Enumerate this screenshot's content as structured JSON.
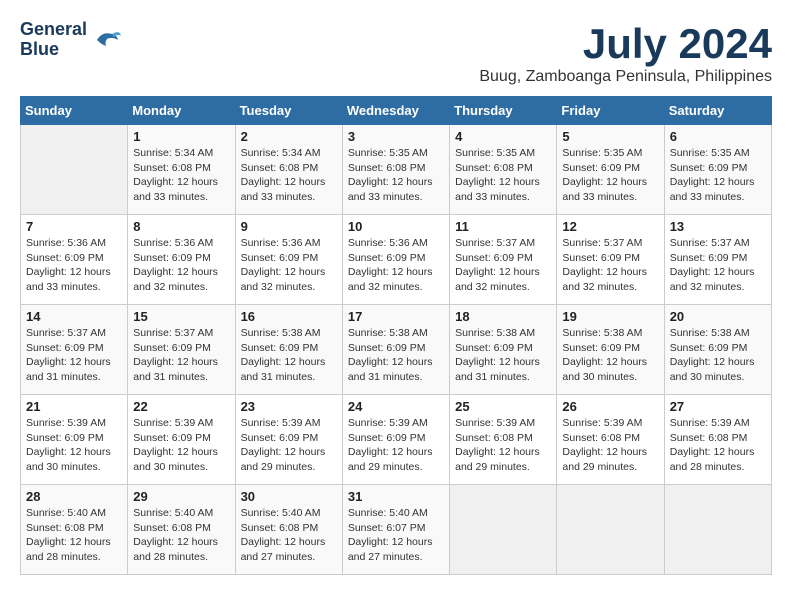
{
  "logo": {
    "line1": "General",
    "line2": "Blue"
  },
  "title": "July 2024",
  "location": "Buug, Zamboanga Peninsula, Philippines",
  "headers": [
    "Sunday",
    "Monday",
    "Tuesday",
    "Wednesday",
    "Thursday",
    "Friday",
    "Saturday"
  ],
  "weeks": [
    [
      {
        "day": "",
        "sunrise": "",
        "sunset": "",
        "daylight": ""
      },
      {
        "day": "1",
        "sunrise": "Sunrise: 5:34 AM",
        "sunset": "Sunset: 6:08 PM",
        "daylight": "Daylight: 12 hours and 33 minutes."
      },
      {
        "day": "2",
        "sunrise": "Sunrise: 5:34 AM",
        "sunset": "Sunset: 6:08 PM",
        "daylight": "Daylight: 12 hours and 33 minutes."
      },
      {
        "day": "3",
        "sunrise": "Sunrise: 5:35 AM",
        "sunset": "Sunset: 6:08 PM",
        "daylight": "Daylight: 12 hours and 33 minutes."
      },
      {
        "day": "4",
        "sunrise": "Sunrise: 5:35 AM",
        "sunset": "Sunset: 6:08 PM",
        "daylight": "Daylight: 12 hours and 33 minutes."
      },
      {
        "day": "5",
        "sunrise": "Sunrise: 5:35 AM",
        "sunset": "Sunset: 6:09 PM",
        "daylight": "Daylight: 12 hours and 33 minutes."
      },
      {
        "day": "6",
        "sunrise": "Sunrise: 5:35 AM",
        "sunset": "Sunset: 6:09 PM",
        "daylight": "Daylight: 12 hours and 33 minutes."
      }
    ],
    [
      {
        "day": "7",
        "sunrise": "Sunrise: 5:36 AM",
        "sunset": "Sunset: 6:09 PM",
        "daylight": "Daylight: 12 hours and 33 minutes."
      },
      {
        "day": "8",
        "sunrise": "Sunrise: 5:36 AM",
        "sunset": "Sunset: 6:09 PM",
        "daylight": "Daylight: 12 hours and 32 minutes."
      },
      {
        "day": "9",
        "sunrise": "Sunrise: 5:36 AM",
        "sunset": "Sunset: 6:09 PM",
        "daylight": "Daylight: 12 hours and 32 minutes."
      },
      {
        "day": "10",
        "sunrise": "Sunrise: 5:36 AM",
        "sunset": "Sunset: 6:09 PM",
        "daylight": "Daylight: 12 hours and 32 minutes."
      },
      {
        "day": "11",
        "sunrise": "Sunrise: 5:37 AM",
        "sunset": "Sunset: 6:09 PM",
        "daylight": "Daylight: 12 hours and 32 minutes."
      },
      {
        "day": "12",
        "sunrise": "Sunrise: 5:37 AM",
        "sunset": "Sunset: 6:09 PM",
        "daylight": "Daylight: 12 hours and 32 minutes."
      },
      {
        "day": "13",
        "sunrise": "Sunrise: 5:37 AM",
        "sunset": "Sunset: 6:09 PM",
        "daylight": "Daylight: 12 hours and 32 minutes."
      }
    ],
    [
      {
        "day": "14",
        "sunrise": "Sunrise: 5:37 AM",
        "sunset": "Sunset: 6:09 PM",
        "daylight": "Daylight: 12 hours and 31 minutes."
      },
      {
        "day": "15",
        "sunrise": "Sunrise: 5:37 AM",
        "sunset": "Sunset: 6:09 PM",
        "daylight": "Daylight: 12 hours and 31 minutes."
      },
      {
        "day": "16",
        "sunrise": "Sunrise: 5:38 AM",
        "sunset": "Sunset: 6:09 PM",
        "daylight": "Daylight: 12 hours and 31 minutes."
      },
      {
        "day": "17",
        "sunrise": "Sunrise: 5:38 AM",
        "sunset": "Sunset: 6:09 PM",
        "daylight": "Daylight: 12 hours and 31 minutes."
      },
      {
        "day": "18",
        "sunrise": "Sunrise: 5:38 AM",
        "sunset": "Sunset: 6:09 PM",
        "daylight": "Daylight: 12 hours and 31 minutes."
      },
      {
        "day": "19",
        "sunrise": "Sunrise: 5:38 AM",
        "sunset": "Sunset: 6:09 PM",
        "daylight": "Daylight: 12 hours and 30 minutes."
      },
      {
        "day": "20",
        "sunrise": "Sunrise: 5:38 AM",
        "sunset": "Sunset: 6:09 PM",
        "daylight": "Daylight: 12 hours and 30 minutes."
      }
    ],
    [
      {
        "day": "21",
        "sunrise": "Sunrise: 5:39 AM",
        "sunset": "Sunset: 6:09 PM",
        "daylight": "Daylight: 12 hours and 30 minutes."
      },
      {
        "day": "22",
        "sunrise": "Sunrise: 5:39 AM",
        "sunset": "Sunset: 6:09 PM",
        "daylight": "Daylight: 12 hours and 30 minutes."
      },
      {
        "day": "23",
        "sunrise": "Sunrise: 5:39 AM",
        "sunset": "Sunset: 6:09 PM",
        "daylight": "Daylight: 12 hours and 29 minutes."
      },
      {
        "day": "24",
        "sunrise": "Sunrise: 5:39 AM",
        "sunset": "Sunset: 6:09 PM",
        "daylight": "Daylight: 12 hours and 29 minutes."
      },
      {
        "day": "25",
        "sunrise": "Sunrise: 5:39 AM",
        "sunset": "Sunset: 6:08 PM",
        "daylight": "Daylight: 12 hours and 29 minutes."
      },
      {
        "day": "26",
        "sunrise": "Sunrise: 5:39 AM",
        "sunset": "Sunset: 6:08 PM",
        "daylight": "Daylight: 12 hours and 29 minutes."
      },
      {
        "day": "27",
        "sunrise": "Sunrise: 5:39 AM",
        "sunset": "Sunset: 6:08 PM",
        "daylight": "Daylight: 12 hours and 28 minutes."
      }
    ],
    [
      {
        "day": "28",
        "sunrise": "Sunrise: 5:40 AM",
        "sunset": "Sunset: 6:08 PM",
        "daylight": "Daylight: 12 hours and 28 minutes."
      },
      {
        "day": "29",
        "sunrise": "Sunrise: 5:40 AM",
        "sunset": "Sunset: 6:08 PM",
        "daylight": "Daylight: 12 hours and 28 minutes."
      },
      {
        "day": "30",
        "sunrise": "Sunrise: 5:40 AM",
        "sunset": "Sunset: 6:08 PM",
        "daylight": "Daylight: 12 hours and 27 minutes."
      },
      {
        "day": "31",
        "sunrise": "Sunrise: 5:40 AM",
        "sunset": "Sunset: 6:07 PM",
        "daylight": "Daylight: 12 hours and 27 minutes."
      },
      {
        "day": "",
        "sunrise": "",
        "sunset": "",
        "daylight": ""
      },
      {
        "day": "",
        "sunrise": "",
        "sunset": "",
        "daylight": ""
      },
      {
        "day": "",
        "sunrise": "",
        "sunset": "",
        "daylight": ""
      }
    ]
  ]
}
